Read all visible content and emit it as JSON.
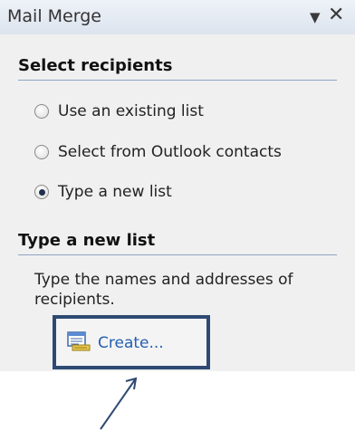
{
  "pane": {
    "title": "Mail Merge",
    "dropdown_icon": "dropdown-triangle-icon",
    "close_icon": "close-x-icon"
  },
  "select_recipients": {
    "heading": "Select recipients",
    "options": [
      {
        "label": "Use an existing list",
        "selected": false
      },
      {
        "label": "Select from Outlook contacts",
        "selected": false
      },
      {
        "label": "Type a new list",
        "selected": true
      }
    ]
  },
  "type_new_list": {
    "heading": "Type a new list",
    "description": "Type the names and addresses of recipients.",
    "create_label": "Create...",
    "create_icon": "address-list-icon"
  },
  "colors": {
    "pane_bg": "#f0f0f0",
    "link": "#2460b0",
    "highlight_border": "#2e4a73",
    "annotation_arrow": "#2e4a73"
  }
}
